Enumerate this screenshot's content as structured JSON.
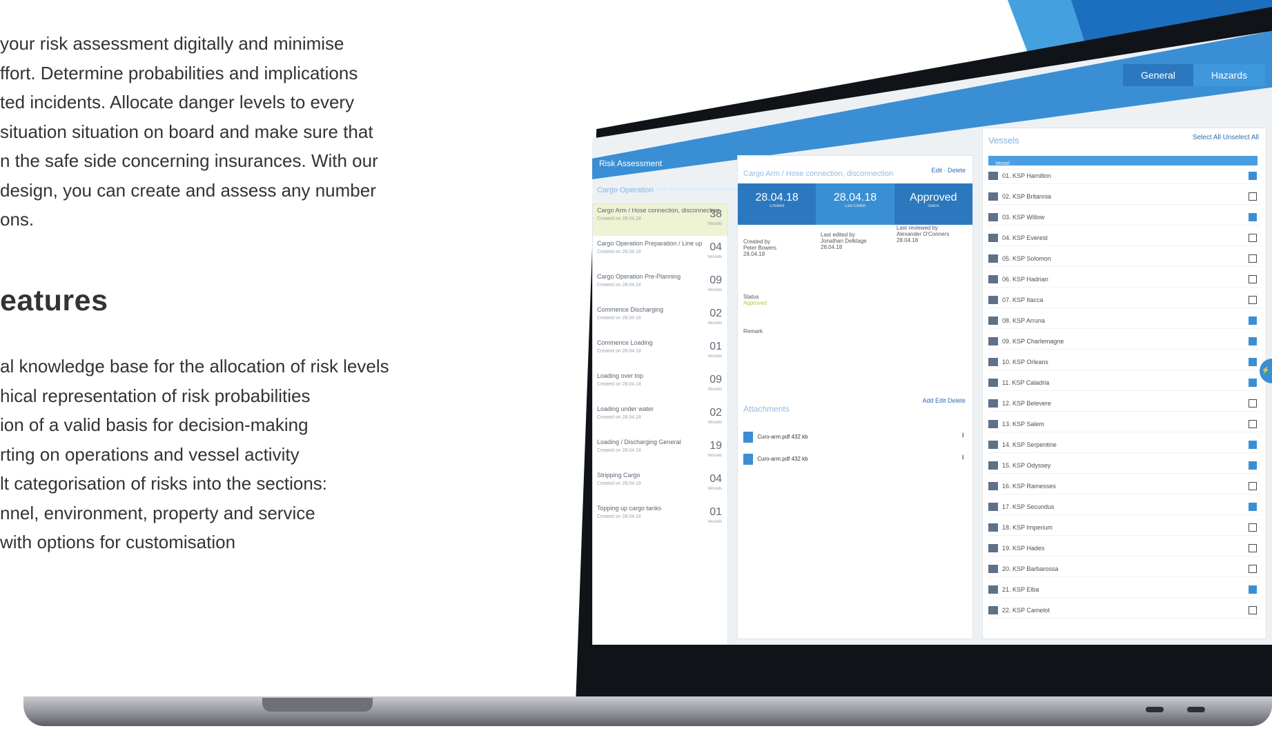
{
  "intro_lines": [
    "your risk assessment digitally and minimise",
    "ffort. Determine probabilities and implications",
    "ted incidents. Allocate danger levels to every",
    "situation situation on board and make sure that",
    "n the safe side concerning insurances. With our",
    "design, you can create and assess any number",
    "ons."
  ],
  "features_heading": "eatures",
  "features": [
    "al knowledge base for the allocation of risk levels",
    "hical representation of risk probabilities",
    "ion of a valid basis for decision-making",
    "rting on operations and vessel activity",
    "lt categorisation of risks into the sections:",
    "nnel, environment, property and service",
    "with options for customisation"
  ],
  "colors": {
    "accent_light": "#45a0e0",
    "accent_dark": "#1c6fbf",
    "highlight_row": "#eef3d4"
  },
  "app": {
    "title": "Risk Assessment",
    "nav": "Dashboard  Operations  Risk Assessments  Matrix  Reports  Settings",
    "tabs": [
      "General",
      "Hazards"
    ],
    "list_header": "Cargo Operation",
    "operations": [
      {
        "title": "Cargo Arm / Hose connection, disconnection",
        "date": "Created on 28.04.18",
        "count": "38",
        "unit": "Vessels"
      },
      {
        "title": "Cargo Operation Preparation / Line up",
        "date": "Created on 28.04.18",
        "count": "04",
        "unit": "Vessels"
      },
      {
        "title": "Cargo Operation Pre-Planning",
        "date": "Created on 28.04.18",
        "count": "09",
        "unit": "Vessels"
      },
      {
        "title": "Commence Discharging",
        "date": "Created on 28.04.18",
        "count": "02",
        "unit": "Vessels"
      },
      {
        "title": "Commence Loading",
        "date": "Created on 28.04.18",
        "count": "01",
        "unit": "Vessels"
      },
      {
        "title": "Loading over top",
        "date": "Created on 28.04.18",
        "count": "09",
        "unit": "Vessels"
      },
      {
        "title": "Loading under water",
        "date": "Created on 28.04.18",
        "count": "02",
        "unit": "Vessels"
      },
      {
        "title": "Loading / Discharging General",
        "date": "Created on 28.04.18",
        "count": "19",
        "unit": "Vessels"
      },
      {
        "title": "Stripping Cargo",
        "date": "Created on 28.04.18",
        "count": "04",
        "unit": "Vessels"
      },
      {
        "title": "Topping up cargo tanks",
        "date": "Created on 28.04.18",
        "count": "01",
        "unit": "Vessels"
      }
    ],
    "detail": {
      "crumb": "Cargo Arm / Hose connection, disconnection",
      "edit": "Edit",
      "delete": "Delete",
      "stats": [
        {
          "value": "28.04.18",
          "label": "Created"
        },
        {
          "value": "28.04.18",
          "label": "Last Edited"
        },
        {
          "value": "Approved",
          "label": "Status"
        }
      ],
      "created_by": "Created by",
      "created_name": "Peter Bowers",
      "created_date": "28.04.18",
      "edited_by": "Last edited by",
      "edited_name": "Jonathan Delktage",
      "edited_date": "28.04.18",
      "reviewed_by": "Last reviewed by",
      "reviewed_name": "Alexander O'Conners",
      "reviewed_date": "28.04.18",
      "status_label": "Status",
      "status_value": "Approved",
      "remark_label": "Remark",
      "attachments_title": "Attachments",
      "attach_actions": "Add  Edit  Delete",
      "files": [
        {
          "name": "Curo-arm.pdf",
          "size": "432 kb",
          "type": "PDF"
        },
        {
          "name": "Curo-arm.pdf",
          "size": "432 kb",
          "type": "DOC"
        }
      ]
    },
    "vessels": {
      "title": "Vessels",
      "select_all": "Select All",
      "unselect_all": "Unselect All",
      "column": "Vessel",
      "items": [
        {
          "name": "01. KSP Hamilton",
          "checked": true
        },
        {
          "name": "02. KSP Britannia",
          "checked": false
        },
        {
          "name": "03. KSP Willow",
          "checked": true
        },
        {
          "name": "04. KSP Everest",
          "checked": false
        },
        {
          "name": "05. KSP Solomon",
          "checked": false
        },
        {
          "name": "06. KSP Hadrian",
          "checked": false
        },
        {
          "name": "07. KSP Itacca",
          "checked": false
        },
        {
          "name": "08. KSP Arruna",
          "checked": true
        },
        {
          "name": "09. KSP Charlemagne",
          "checked": true
        },
        {
          "name": "10. KSP Orleans",
          "checked": true
        },
        {
          "name": "11. KSP Caladria",
          "checked": true
        },
        {
          "name": "12. KSP Belevere",
          "checked": false
        },
        {
          "name": "13. KSP Salem",
          "checked": false
        },
        {
          "name": "14. KSP Serpentine",
          "checked": true
        },
        {
          "name": "15. KSP Odyssey",
          "checked": true
        },
        {
          "name": "16. KSP Ramesses",
          "checked": false
        },
        {
          "name": "17. KSP Secundus",
          "checked": true
        },
        {
          "name": "18. KSP Imperium",
          "checked": false
        },
        {
          "name": "19. KSP Hades",
          "checked": false
        },
        {
          "name": "20. KSP Barbarossa",
          "checked": false
        },
        {
          "name": "21. KSP Elba",
          "checked": true
        },
        {
          "name": "22. KSP Camelot",
          "checked": false
        }
      ]
    }
  }
}
